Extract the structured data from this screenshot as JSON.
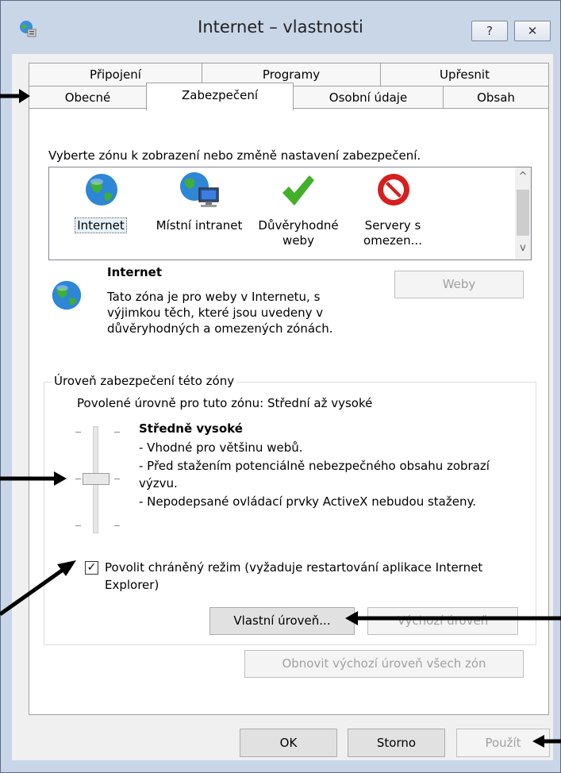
{
  "window": {
    "title": "Internet – vlastnosti",
    "help_label": "?",
    "close_label": "✕"
  },
  "tabs": {
    "row1": [
      "Připojení",
      "Programy",
      "Upřesnit"
    ],
    "row2": [
      "Obecné",
      "Zabezpečení",
      "Osobní údaje",
      "Obsah"
    ],
    "active": "Zabezpečení"
  },
  "zones": {
    "prompt": "Vyberte zónu k zobrazení nebo změně nastavení zabezpečení.",
    "items": [
      {
        "label": "Internet",
        "icon": "globe-icon"
      },
      {
        "label": "Místní intranet",
        "icon": "intranet-icon"
      },
      {
        "label_line1": "Důvěryhodné",
        "label_line2": "weby",
        "icon": "checkmark-icon"
      },
      {
        "label_line1": "Servery s",
        "label_line2": "omezen...",
        "icon": "prohibited-icon"
      }
    ],
    "scroll_up": "^",
    "scroll_down": "v"
  },
  "selected_zone": {
    "name": "Internet",
    "description_lines": [
      "Tato zóna je pro weby v Internetu, s",
      "výjimkou těch, které jsou uvedeny v",
      "důvěryhodných a omezených zónách."
    ],
    "sites_button": "Weby"
  },
  "security_level": {
    "group_title": "Úroveň zabezpečení této zóny",
    "allowed_levels": "Povolené úrovně pro tuto zónu: Střední až vysoké",
    "level_name": "Středně vysoké",
    "bullets": [
      "- Vhodné pro většinu webů.",
      "- Před stažením potenciálně nebezpečného obsahu zobrazí",
      "výzvu.",
      "- Nepodepsané ovládací prvky ActiveX nebudou staženy."
    ],
    "slider_level_of_4": 3,
    "protected_mode_line1": "Povolit chráněný režim (vyžaduje restartování aplikace Internet",
    "protected_mode_line2": "Explorer)",
    "protected_mode_checked": true,
    "custom_level_button": "Vlastní úroveň...",
    "default_level_button": "Výchozí úroveň",
    "reset_all_button": "Obnovit výchozí úroveň všech zón"
  },
  "footer": {
    "ok": "OK",
    "cancel": "Storno",
    "apply": "Použít"
  },
  "colors": {
    "frame": "#c9d6e8",
    "callout_arrow": "#000000",
    "disabled_text": "#a0a0a0"
  }
}
